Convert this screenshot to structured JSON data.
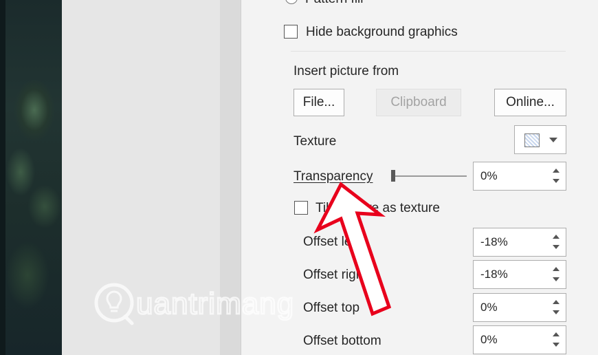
{
  "fill_options": {
    "pattern_fill_label": "Pattern fill",
    "hide_background_label": "Hide background graphics"
  },
  "insert_picture": {
    "heading": "Insert picture from",
    "file_button": "File...",
    "clipboard_button": "Clipboard",
    "online_button": "Online..."
  },
  "texture": {
    "label": "Texture",
    "swatch_icon": "texture-swatch-icon"
  },
  "transparency": {
    "label": "Transparency",
    "value_text": "0%",
    "value": 0
  },
  "tile": {
    "label": "Tile picture as texture"
  },
  "offsets": [
    {
      "label": "Offset left",
      "value": "-18%"
    },
    {
      "label": "Offset right",
      "value": "-18%"
    },
    {
      "label": "Offset top",
      "value": "0%"
    },
    {
      "label": "Offset bottom",
      "value": "0%"
    }
  ],
  "watermark": {
    "text": "uantrimang",
    "brand_letter": "Q"
  },
  "colors": {
    "pane_background": "#f3f3f3",
    "annotation_arrow": "#e8001c",
    "watermark": "#ffffff"
  }
}
